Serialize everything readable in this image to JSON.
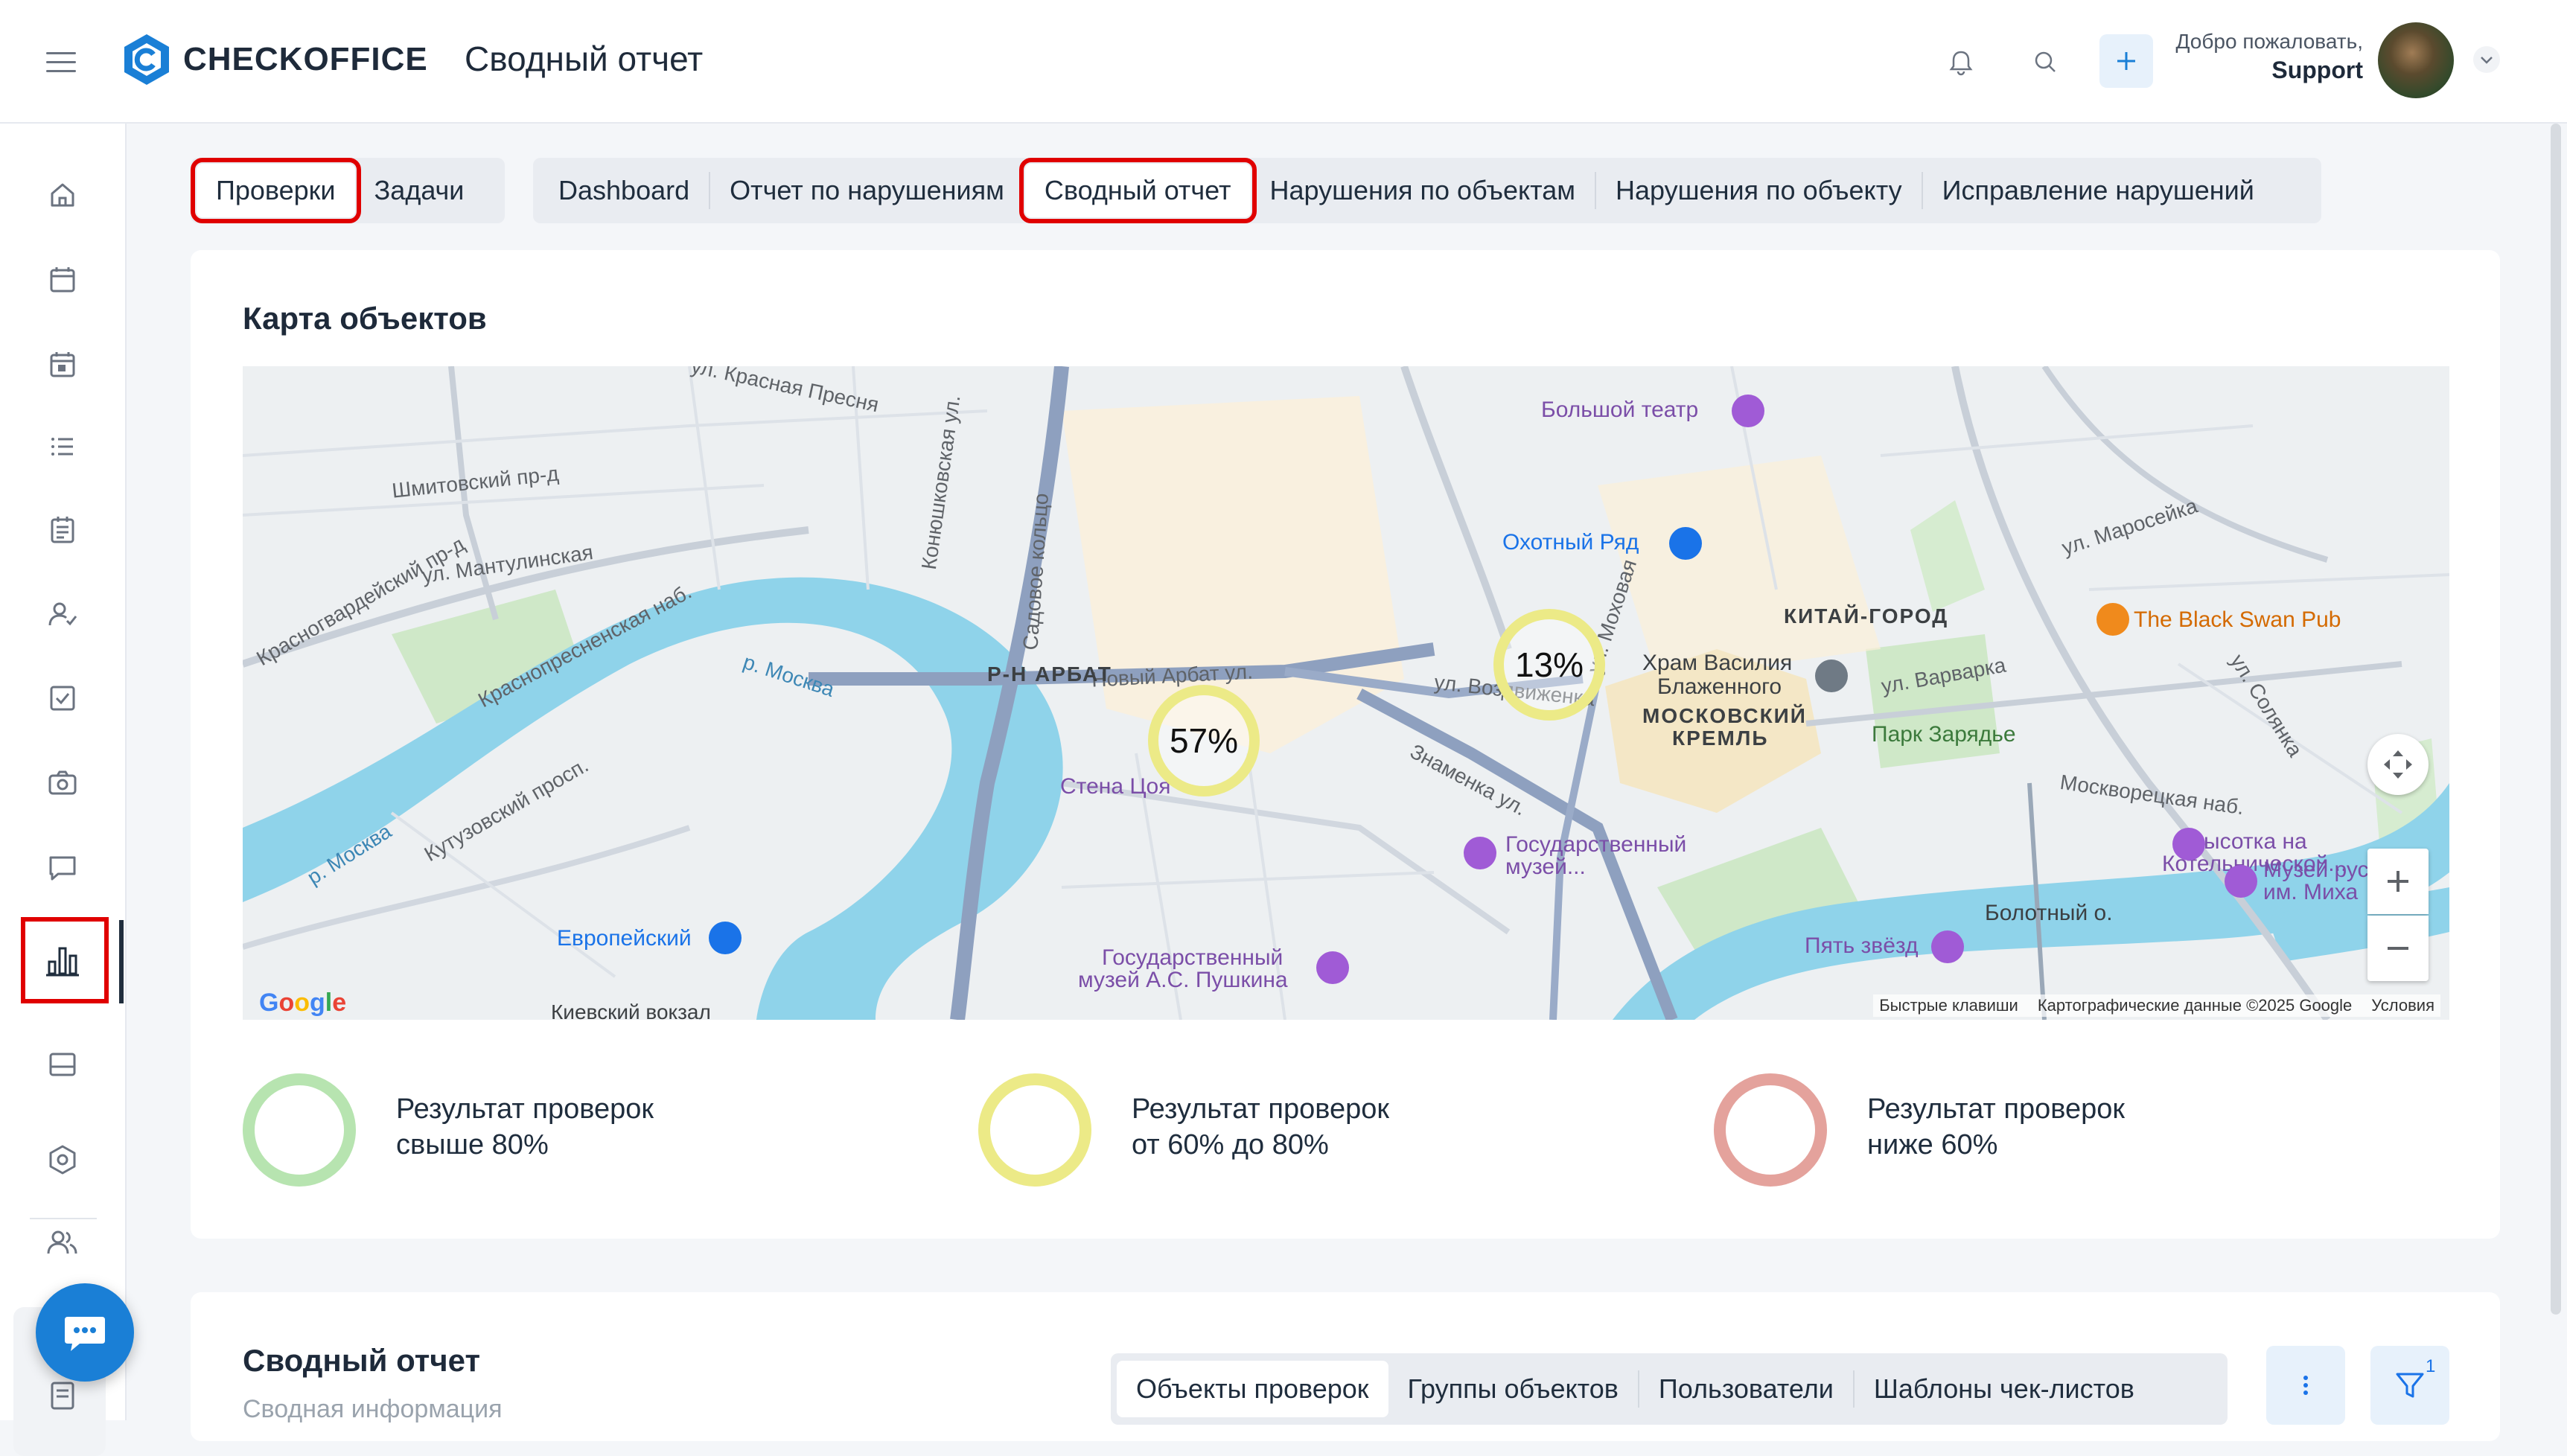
{
  "header": {
    "logo_text": "CHECKOFFICE",
    "title": "Сводный отчет",
    "welcome": "Добро пожаловать,",
    "user_name": "Support"
  },
  "tabs_primary": [
    {
      "label": "Проверки",
      "selected": true
    },
    {
      "label": "Задачи",
      "selected": false
    }
  ],
  "tabs_secondary": [
    {
      "label": "Dashboard",
      "selected": false
    },
    {
      "label": "Отчет по нарушениям",
      "selected": false
    },
    {
      "label": "Сводный отчет",
      "selected": true
    },
    {
      "label": "Нарушения по объектам",
      "selected": false
    },
    {
      "label": "Нарушения по объекту",
      "selected": false
    },
    {
      "label": "Исправление нарушений",
      "selected": false
    }
  ],
  "map_card": {
    "title": "Карта объектов",
    "clusters": [
      {
        "label": "13%"
      },
      {
        "label": "57%"
      }
    ],
    "streets": {
      "krasnaya_presnya": "ул. Красная Пресня",
      "shmitovsky": "Шмитовский пр-д",
      "mantulinskaya": "ул. Мантулинская",
      "krasnopresnenskaya": "Краснопресненская наб.",
      "krasnogvardeysky": "Красногвардейский пр-д",
      "kutuzovsky": "Кутузовский просп.",
      "moskva_river_1": "р. Москва",
      "moskva_river_2": "р. Москва",
      "konyushkovskaya": "Конюшковская ул.",
      "sadovoe": "Садовое кольцо",
      "noviy_arbat": "Новый Арбат ул.",
      "vozdvizhenka": "ул. Воздвиженка",
      "znamenka": "Знаменка ул.",
      "mokhovaya": "ул. Моховая",
      "maroseyka": "ул. Маросейка",
      "varvarka": "ул. Варварка",
      "solyanka": "ул. Солянка",
      "moskvoretskaya": "Москворецкая наб.",
      "bolotny": "Болотный о."
    },
    "districts": {
      "arbat": "Р-Н АРБАТ",
      "kitay_gorod": "КИТАЙ-ГОРОД",
      "kremlin_1": "МОСКОВСКИЙ",
      "kremlin_2": "КРЕМЛЬ"
    },
    "pois": {
      "bolshoi": "Большой театр",
      "okhotny": "Охотный Ряд",
      "basil_1": "Храм Василия",
      "basil_2": "Блаженного",
      "zaryadye": "Парк Зарядье",
      "black_swan": "The Black Swan Pub",
      "stena": "Стена Цоя",
      "gos_muzey_1": "Государственный",
      "gos_muzey_2": "музей...",
      "pushkin_1": "Государственный",
      "pushkin_2": "музей А.С. Пушкина",
      "evropeisky": "Европейский",
      "kievsky": "Киевский вокзал",
      "vysotka_1": "Высотка на",
      "vysotka_2": "Котельнической...",
      "muzey_rus_1": "Музей рус",
      "muzey_rus_2": "им. Миха",
      "pyat_zvezd": "Пять звёзд"
    },
    "footer": {
      "shortcuts": "Быстрые клавиши",
      "map_data": "Картографические данные ©2025 Google",
      "terms": "Условия"
    },
    "google": "Google",
    "legend": [
      {
        "line1": "Результат проверок",
        "line2": "свыше 80%",
        "color": "#b7e4b0"
      },
      {
        "line1": "Результат проверок",
        "line2": "от 60% до 80%",
        "color": "#ecea87"
      },
      {
        "line1": "Результат проверок",
        "line2": "ниже 60%",
        "color": "#e4a29c"
      }
    ]
  },
  "summary_card": {
    "title": "Сводный отчет",
    "subtitle": "Сводная информация",
    "tabs": [
      {
        "label": "Объекты проверок",
        "active": true
      },
      {
        "label": "Группы объектов",
        "active": false
      },
      {
        "label": "Пользователи",
        "active": false
      },
      {
        "label": "Шаблоны чек-листов",
        "active": false
      }
    ],
    "filter_count": "1"
  },
  "colors": {
    "accent": "#1a7fd6",
    "selection_outline": "#e00000",
    "cluster_yellow": "#ecea87"
  },
  "icons": {
    "sidebar": [
      "home-icon",
      "calendar-icon",
      "calendar-day-icon",
      "list-icon",
      "clipboard-icon",
      "user-check-icon",
      "checkbox-icon",
      "camera-icon",
      "chat-icon",
      "bar-chart-icon",
      "inbox-icon",
      "settings-icon",
      "users-icon",
      "document-icon"
    ]
  }
}
